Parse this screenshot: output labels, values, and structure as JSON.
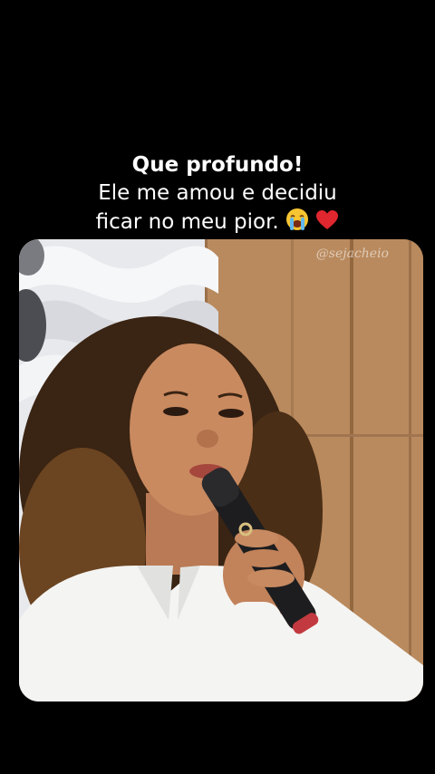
{
  "caption": {
    "title": "Que profundo!",
    "line1": "Ele me amou e decidiu",
    "line2": "ficar no meu pior."
  },
  "icons": {
    "crying_face": "crying-face-icon",
    "heart": "red-heart-icon"
  },
  "video": {
    "watermark": "@sejacheio"
  },
  "colors": {
    "background": "#000000",
    "caption_text": "#ffffff",
    "heart": "#e0262f",
    "shirt": "#f4f4f2",
    "wood_panel": "#b98a5e"
  }
}
